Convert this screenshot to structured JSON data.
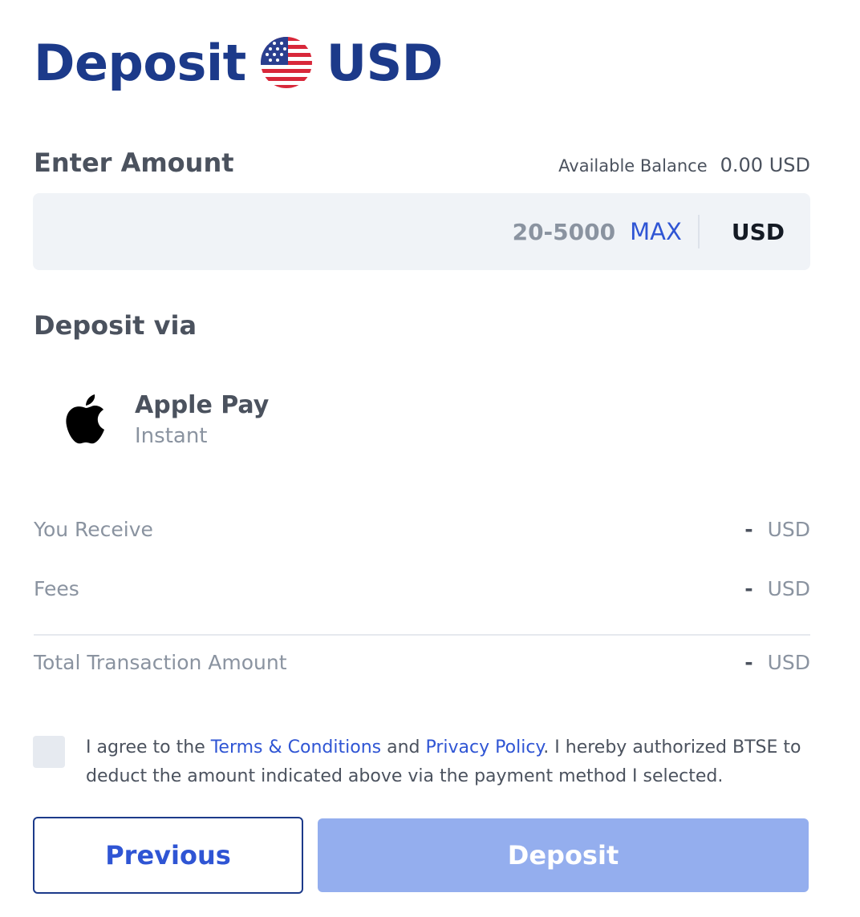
{
  "header": {
    "title_prefix": "Deposit",
    "currency": "USD",
    "flag_icon": "us-flag-icon"
  },
  "amount": {
    "label": "Enter Amount",
    "balance_label": "Available Balance",
    "balance_value": "0.00 USD",
    "placeholder": "20-5000",
    "max_label": "MAX",
    "currency": "USD"
  },
  "deposit_via": {
    "label": "Deposit via",
    "method": {
      "icon": "apple-icon",
      "name": "Apple Pay",
      "speed": "Instant"
    }
  },
  "summary": {
    "rows": [
      {
        "label": "You Receive",
        "value": "-",
        "currency": "USD"
      },
      {
        "label": "Fees",
        "value": "-",
        "currency": "USD"
      },
      {
        "label": "Total Transaction Amount",
        "value": "-",
        "currency": "USD"
      }
    ]
  },
  "agreement": {
    "text_1": "I agree to the ",
    "terms_link": "Terms & Conditions",
    "text_2": " and ",
    "privacy_link": "Privacy Policy",
    "text_3": ". I hereby authorized BTSE to deduct the amount indicated above via the payment method I selected.",
    "checked": false
  },
  "buttons": {
    "previous": "Previous",
    "deposit": "Deposit"
  },
  "colors": {
    "brand_navy": "#1c3a8a",
    "link_blue": "#2f55d4",
    "deposit_disabled": "#94aeee",
    "input_bg": "#f0f3f7"
  }
}
